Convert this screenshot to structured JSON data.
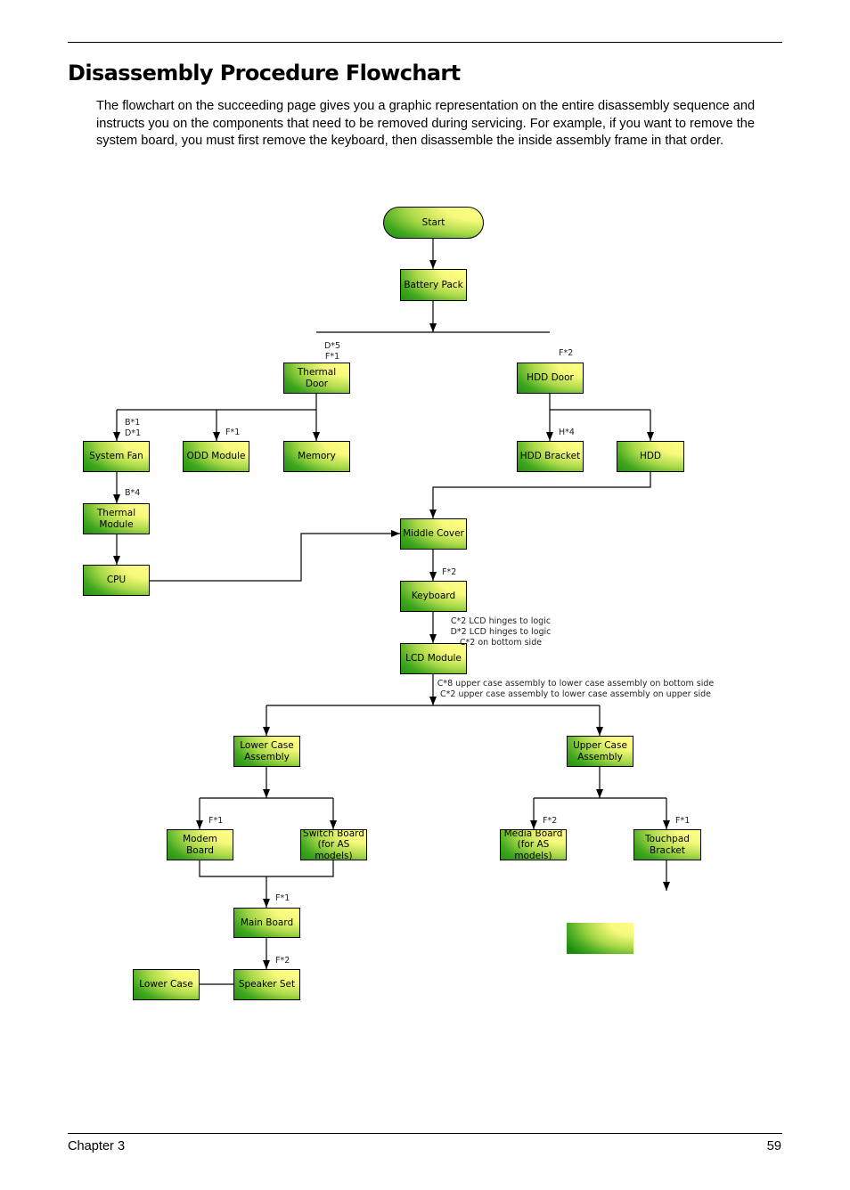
{
  "page": {
    "title": "Disassembly Procedure Flowchart",
    "intro": "The flowchart on the succeeding page gives you a graphic representation on the entire disassembly sequence and instructs you on the components that need to be removed during servicing. For example, if you want to remove the system board, you must first remove the keyboard, then disassemble the inside assembly frame in that order.",
    "footer": {
      "chapter": "Chapter 3",
      "page_number": "59"
    }
  },
  "colors": {
    "node_gradient_light": "#ffff88",
    "node_gradient_dark": "#1d8a10",
    "line": "#000000"
  },
  "flowchart": {
    "nodes": {
      "start": "Start",
      "battery_pack": "Battery Pack",
      "thermal_door": "Thermal\nDoor",
      "hdd_door": "HDD Door",
      "system_fan": "System Fan",
      "odd_module": "ODD Module",
      "memory": "Memory",
      "hdd_bracket": "HDD Bracket",
      "hdd": "HDD",
      "thermal_module": "Thermal\nModule",
      "cpu": "CPU",
      "middle_cover": "Middle Cover",
      "keyboard": "Keyboard",
      "lcd_module": "LCD Module",
      "lower_case_assembly": "Lower Case\nAssembly",
      "upper_case_assembly": "Upper Case\nAssembly",
      "modem_board": "Modem\nBoard",
      "switch_board": "Switch Board\n(for AS\nmodels)",
      "media_board": "Media Board\n(for AS\nmodels)",
      "touchpad_bracket": "Touchpad\nBracket",
      "main_board": "Main Board",
      "speaker_set": "Speaker Set",
      "lower_case": "Lower Case"
    },
    "screw_labels": {
      "thermal_door": "D*5\nF*1",
      "hdd_door": "F*2",
      "system_fan": "B*1\nD*1",
      "odd_module": "F*1",
      "hdd_bracket": "H*4",
      "thermal_module": "B*4",
      "keyboard": "F*2",
      "lcd_module": "C*2 LCD hinges to logic\nD*2 LCD hinges to logic\nC*2 on bottom side",
      "case_split": "C*8 upper case assembly to lower case assembly on bottom side\nC*2 upper case assembly to lower case assembly on upper side",
      "modem_board": "F*1",
      "media_board": "F*2",
      "touchpad_bracket": "F*1",
      "main_board": "F*1",
      "speaker_set": "F*2"
    }
  }
}
